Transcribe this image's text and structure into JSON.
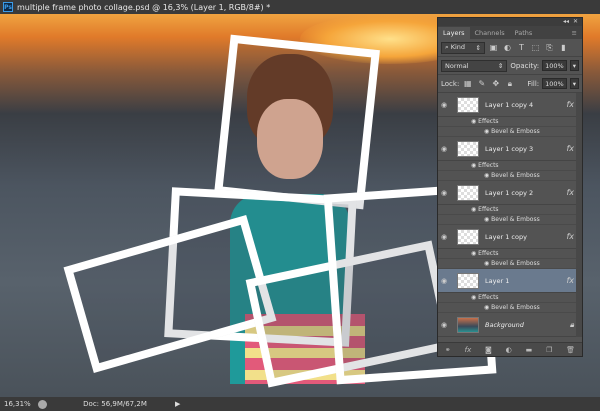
{
  "window": {
    "title": "multiple frame photo collage.psd @ 16,3% (Layer 1, RGB/8#) *",
    "app_icon": "Ps"
  },
  "status": {
    "zoom": "16,31%",
    "doc": "Doc: 56,9M/67,2M"
  },
  "panel": {
    "tabs": [
      "Layers",
      "Channels",
      "Paths"
    ],
    "filter": "Kind",
    "blend_mode": "Normal",
    "opacity_label": "Opacity:",
    "opacity": "100%",
    "lock_label": "Lock:",
    "fill_label": "Fill:",
    "fill": "100%",
    "effects_label": "Effects",
    "bevel_label": "Bevel & Emboss",
    "layers": [
      {
        "name": "Layer 1 copy 4"
      },
      {
        "name": "Layer 1 copy 3"
      },
      {
        "name": "Layer 1 copy 2"
      },
      {
        "name": "Layer 1 copy"
      },
      {
        "name": "Layer 1",
        "selected": true
      },
      {
        "name": "Background"
      }
    ]
  }
}
